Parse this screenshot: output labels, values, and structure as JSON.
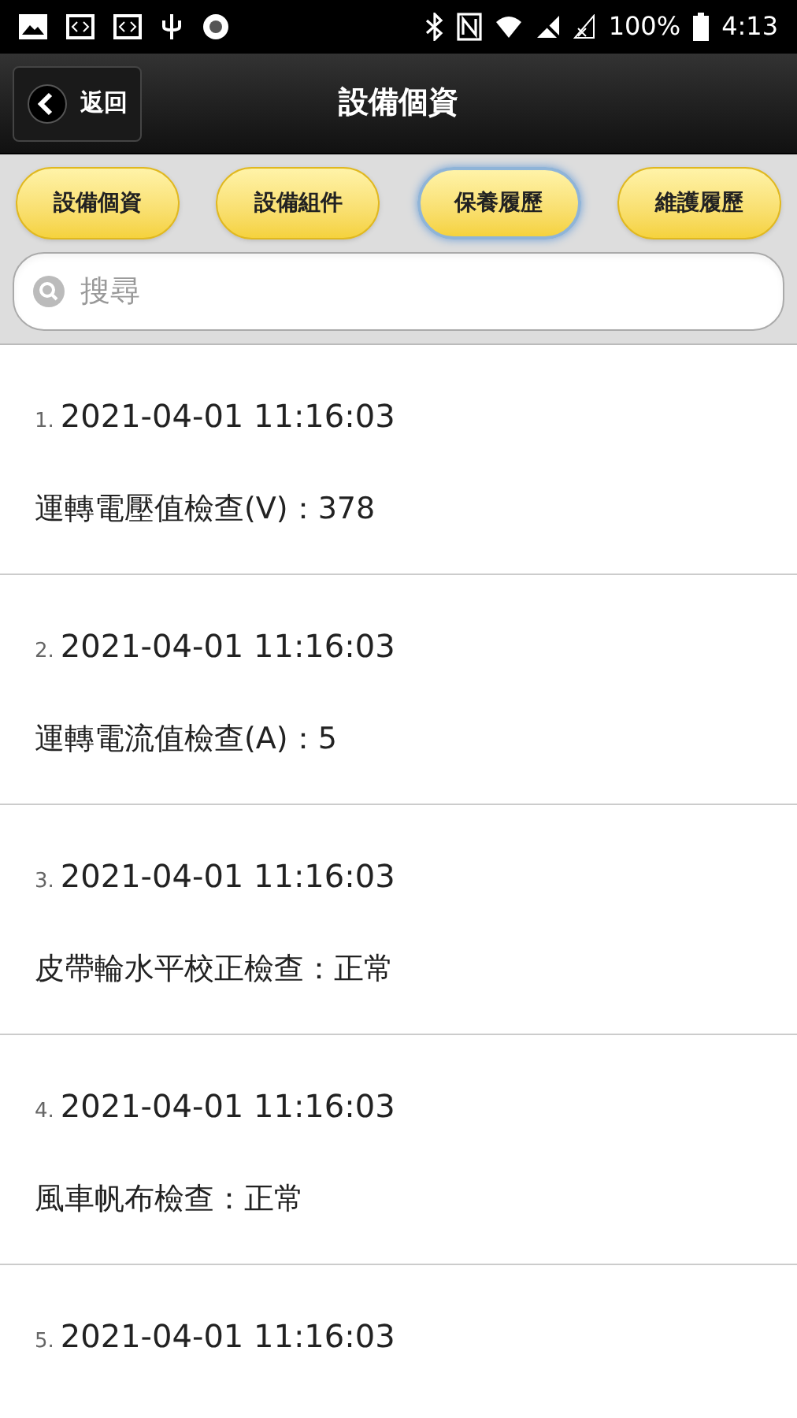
{
  "status_bar": {
    "battery": "100%",
    "time": "4:13"
  },
  "header": {
    "back": "返回",
    "title": "設備個資"
  },
  "tabs": [
    {
      "label": "設備個資",
      "selected": false
    },
    {
      "label": "設備組件",
      "selected": false
    },
    {
      "label": "保養履歷",
      "selected": true
    },
    {
      "label": "維護履歷",
      "selected": false
    }
  ],
  "search": {
    "placeholder": "搜尋"
  },
  "records": [
    {
      "index": "1.",
      "datetime": "2021-04-01 11:16:03",
      "detail": "運轉電壓值檢查(V)：378"
    },
    {
      "index": "2.",
      "datetime": "2021-04-01 11:16:03",
      "detail": "運轉電流值檢查(A)：5"
    },
    {
      "index": "3.",
      "datetime": "2021-04-01 11:16:03",
      "detail": "皮帶輪水平校正檢查：正常"
    },
    {
      "index": "4.",
      "datetime": "2021-04-01 11:16:03",
      "detail": "風車帆布檢查：正常"
    },
    {
      "index": "5.",
      "datetime": "2021-04-01 11:16:03"
    }
  ]
}
